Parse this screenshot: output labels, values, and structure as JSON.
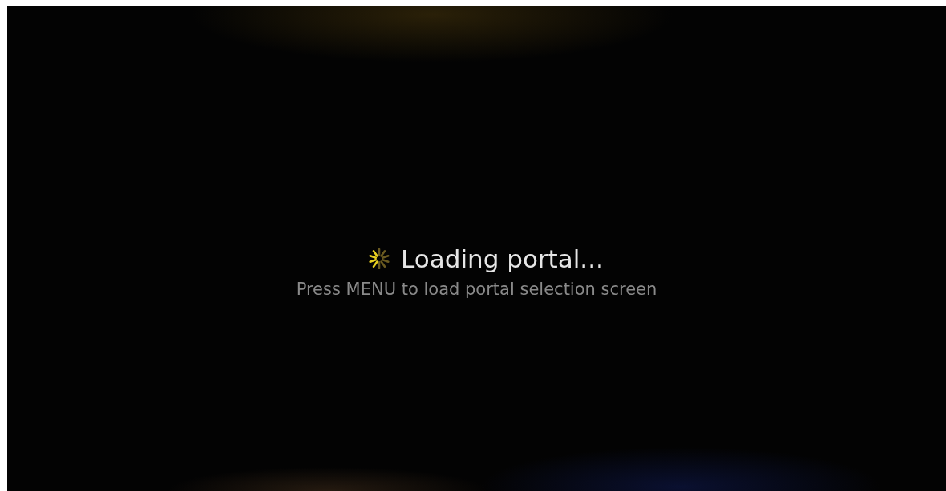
{
  "loading": {
    "title": "Loading portal...",
    "hint": "Press MENU to load portal selection screen"
  }
}
